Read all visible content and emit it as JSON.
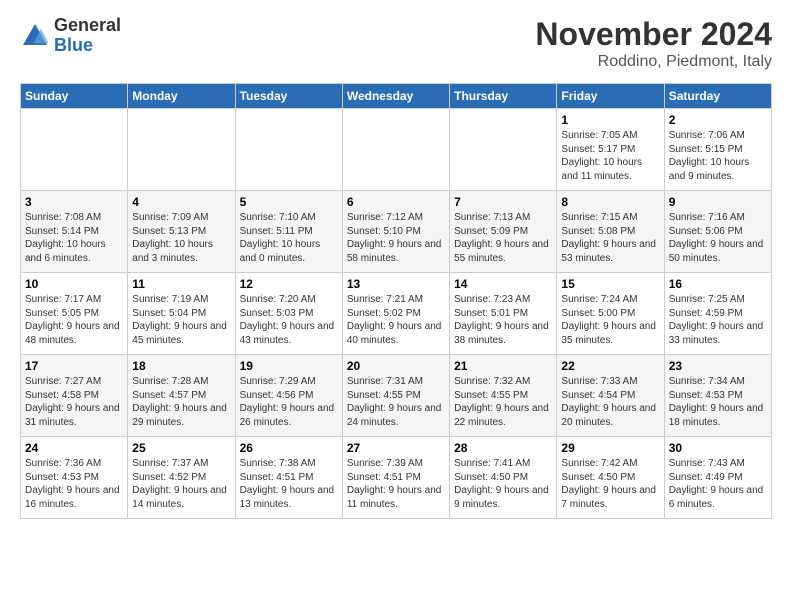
{
  "logo": {
    "line1": "General",
    "line2": "Blue"
  },
  "header": {
    "month": "November 2024",
    "location": "Roddino, Piedmont, Italy"
  },
  "weekdays": [
    "Sunday",
    "Monday",
    "Tuesday",
    "Wednesday",
    "Thursday",
    "Friday",
    "Saturday"
  ],
  "weeks": [
    [
      {
        "day": "",
        "info": ""
      },
      {
        "day": "",
        "info": ""
      },
      {
        "day": "",
        "info": ""
      },
      {
        "day": "",
        "info": ""
      },
      {
        "day": "",
        "info": ""
      },
      {
        "day": "1",
        "info": "Sunrise: 7:05 AM\nSunset: 5:17 PM\nDaylight: 10 hours and 11 minutes."
      },
      {
        "day": "2",
        "info": "Sunrise: 7:06 AM\nSunset: 5:15 PM\nDaylight: 10 hours and 9 minutes."
      }
    ],
    [
      {
        "day": "3",
        "info": "Sunrise: 7:08 AM\nSunset: 5:14 PM\nDaylight: 10 hours and 6 minutes."
      },
      {
        "day": "4",
        "info": "Sunrise: 7:09 AM\nSunset: 5:13 PM\nDaylight: 10 hours and 3 minutes."
      },
      {
        "day": "5",
        "info": "Sunrise: 7:10 AM\nSunset: 5:11 PM\nDaylight: 10 hours and 0 minutes."
      },
      {
        "day": "6",
        "info": "Sunrise: 7:12 AM\nSunset: 5:10 PM\nDaylight: 9 hours and 58 minutes."
      },
      {
        "day": "7",
        "info": "Sunrise: 7:13 AM\nSunset: 5:09 PM\nDaylight: 9 hours and 55 minutes."
      },
      {
        "day": "8",
        "info": "Sunrise: 7:15 AM\nSunset: 5:08 PM\nDaylight: 9 hours and 53 minutes."
      },
      {
        "day": "9",
        "info": "Sunrise: 7:16 AM\nSunset: 5:06 PM\nDaylight: 9 hours and 50 minutes."
      }
    ],
    [
      {
        "day": "10",
        "info": "Sunrise: 7:17 AM\nSunset: 5:05 PM\nDaylight: 9 hours and 48 minutes."
      },
      {
        "day": "11",
        "info": "Sunrise: 7:19 AM\nSunset: 5:04 PM\nDaylight: 9 hours and 45 minutes."
      },
      {
        "day": "12",
        "info": "Sunrise: 7:20 AM\nSunset: 5:03 PM\nDaylight: 9 hours and 43 minutes."
      },
      {
        "day": "13",
        "info": "Sunrise: 7:21 AM\nSunset: 5:02 PM\nDaylight: 9 hours and 40 minutes."
      },
      {
        "day": "14",
        "info": "Sunrise: 7:23 AM\nSunset: 5:01 PM\nDaylight: 9 hours and 38 minutes."
      },
      {
        "day": "15",
        "info": "Sunrise: 7:24 AM\nSunset: 5:00 PM\nDaylight: 9 hours and 35 minutes."
      },
      {
        "day": "16",
        "info": "Sunrise: 7:25 AM\nSunset: 4:59 PM\nDaylight: 9 hours and 33 minutes."
      }
    ],
    [
      {
        "day": "17",
        "info": "Sunrise: 7:27 AM\nSunset: 4:58 PM\nDaylight: 9 hours and 31 minutes."
      },
      {
        "day": "18",
        "info": "Sunrise: 7:28 AM\nSunset: 4:57 PM\nDaylight: 9 hours and 29 minutes."
      },
      {
        "day": "19",
        "info": "Sunrise: 7:29 AM\nSunset: 4:56 PM\nDaylight: 9 hours and 26 minutes."
      },
      {
        "day": "20",
        "info": "Sunrise: 7:31 AM\nSunset: 4:55 PM\nDaylight: 9 hours and 24 minutes."
      },
      {
        "day": "21",
        "info": "Sunrise: 7:32 AM\nSunset: 4:55 PM\nDaylight: 9 hours and 22 minutes."
      },
      {
        "day": "22",
        "info": "Sunrise: 7:33 AM\nSunset: 4:54 PM\nDaylight: 9 hours and 20 minutes."
      },
      {
        "day": "23",
        "info": "Sunrise: 7:34 AM\nSunset: 4:53 PM\nDaylight: 9 hours and 18 minutes."
      }
    ],
    [
      {
        "day": "24",
        "info": "Sunrise: 7:36 AM\nSunset: 4:53 PM\nDaylight: 9 hours and 16 minutes."
      },
      {
        "day": "25",
        "info": "Sunrise: 7:37 AM\nSunset: 4:52 PM\nDaylight: 9 hours and 14 minutes."
      },
      {
        "day": "26",
        "info": "Sunrise: 7:38 AM\nSunset: 4:51 PM\nDaylight: 9 hours and 13 minutes."
      },
      {
        "day": "27",
        "info": "Sunrise: 7:39 AM\nSunset: 4:51 PM\nDaylight: 9 hours and 11 minutes."
      },
      {
        "day": "28",
        "info": "Sunrise: 7:41 AM\nSunset: 4:50 PM\nDaylight: 9 hours and 9 minutes."
      },
      {
        "day": "29",
        "info": "Sunrise: 7:42 AM\nSunset: 4:50 PM\nDaylight: 9 hours and 7 minutes."
      },
      {
        "day": "30",
        "info": "Sunrise: 7:43 AM\nSunset: 4:49 PM\nDaylight: 9 hours and 6 minutes."
      }
    ]
  ]
}
